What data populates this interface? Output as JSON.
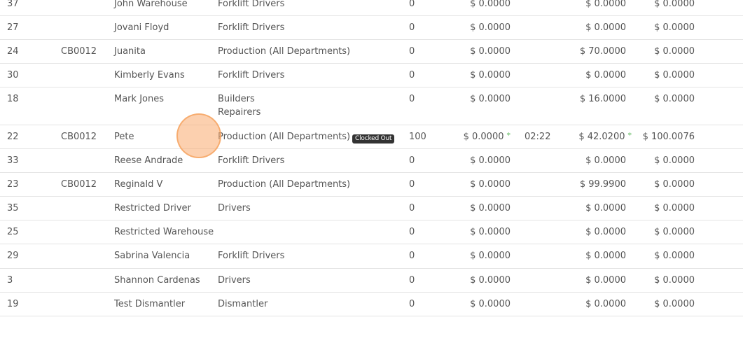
{
  "rows": [
    {
      "id": "37",
      "code": "",
      "name": "John Warehouse",
      "dept": [
        "Forklift Drivers"
      ],
      "status": "",
      "hours": "0",
      "rate": "$ 0.0000",
      "rate_star": "",
      "time": "",
      "cost": "$ 0.0000",
      "cost_star": "",
      "total": "$ 0.0000"
    },
    {
      "id": "27",
      "code": "",
      "name": "Jovani Floyd",
      "dept": [
        "Forklift Drivers"
      ],
      "status": "",
      "hours": "0",
      "rate": "$ 0.0000",
      "rate_star": "",
      "time": "",
      "cost": "$ 0.0000",
      "cost_star": "",
      "total": "$ 0.0000"
    },
    {
      "id": "24",
      "code": "CB0012",
      "name": "Juanita",
      "dept": [
        "Production (All Departments)"
      ],
      "status": "",
      "hours": "0",
      "rate": "$ 0.0000",
      "rate_star": "",
      "time": "",
      "cost": "$ 70.0000",
      "cost_star": "",
      "total": "$ 0.0000"
    },
    {
      "id": "30",
      "code": "",
      "name": "Kimberly Evans",
      "dept": [
        "Forklift Drivers"
      ],
      "status": "",
      "hours": "0",
      "rate": "$ 0.0000",
      "rate_star": "",
      "time": "",
      "cost": "$ 0.0000",
      "cost_star": "",
      "total": "$ 0.0000"
    },
    {
      "id": "18",
      "code": "",
      "name": "Mark Jones",
      "dept": [
        "Builders",
        "Repairers"
      ],
      "status": "",
      "hours": "0",
      "rate": "$ 0.0000",
      "rate_star": "",
      "time": "",
      "cost": "$ 16.0000",
      "cost_star": "",
      "total": "$ 0.0000"
    },
    {
      "id": "22",
      "code": "CB0012",
      "name": "Pete",
      "dept": [
        "Production (All Departments)"
      ],
      "status": "Clocked Out",
      "hours": "100",
      "rate": "$ 0.0000",
      "rate_star": "*",
      "time": "02:22",
      "cost": "$ 42.0200",
      "cost_star": "*",
      "total": "$ 100.0076"
    },
    {
      "id": "33",
      "code": "",
      "name": "Reese Andrade",
      "dept": [
        "Forklift Drivers"
      ],
      "status": "",
      "hours": "0",
      "rate": "$ 0.0000",
      "rate_star": "",
      "time": "",
      "cost": "$ 0.0000",
      "cost_star": "",
      "total": "$ 0.0000"
    },
    {
      "id": "23",
      "code": "CB0012",
      "name": "Reginald V",
      "dept": [
        "Production (All Departments)"
      ],
      "status": "",
      "hours": "0",
      "rate": "$ 0.0000",
      "rate_star": "",
      "time": "",
      "cost": "$ 99.9900",
      "cost_star": "",
      "total": "$ 0.0000"
    },
    {
      "id": "35",
      "code": "",
      "name": "Restricted Driver",
      "dept": [
        "Drivers"
      ],
      "status": "",
      "hours": "0",
      "rate": "$ 0.0000",
      "rate_star": "",
      "time": "",
      "cost": "$ 0.0000",
      "cost_star": "",
      "total": "$ 0.0000"
    },
    {
      "id": "25",
      "code": "",
      "name": "Restricted Warehouse",
      "dept": [],
      "status": "",
      "hours": "0",
      "rate": "$ 0.0000",
      "rate_star": "",
      "time": "",
      "cost": "$ 0.0000",
      "cost_star": "",
      "total": "$ 0.0000"
    },
    {
      "id": "29",
      "code": "",
      "name": "Sabrina Valencia",
      "dept": [
        "Forklift Drivers"
      ],
      "status": "",
      "hours": "0",
      "rate": "$ 0.0000",
      "rate_star": "",
      "time": "",
      "cost": "$ 0.0000",
      "cost_star": "",
      "total": "$ 0.0000"
    },
    {
      "id": "3",
      "code": "",
      "name": "Shannon Cardenas",
      "dept": [
        "Drivers"
      ],
      "status": "",
      "hours": "0",
      "rate": "$ 0.0000",
      "rate_star": "",
      "time": "",
      "cost": "$ 0.0000",
      "cost_star": "",
      "total": "$ 0.0000"
    },
    {
      "id": "19",
      "code": "",
      "name": "Test Dismantler",
      "dept": [
        "Dismantler"
      ],
      "status": "",
      "hours": "0",
      "rate": "$ 0.0000",
      "rate_star": "",
      "time": "",
      "cost": "$ 0.0000",
      "cost_star": "",
      "total": "$ 0.0000"
    }
  ],
  "colors": {
    "text": "#555555",
    "border": "#e4e4e4",
    "badge_bg": "#333333",
    "star": "#5cb85c",
    "click_marker": "#f5a05a"
  }
}
